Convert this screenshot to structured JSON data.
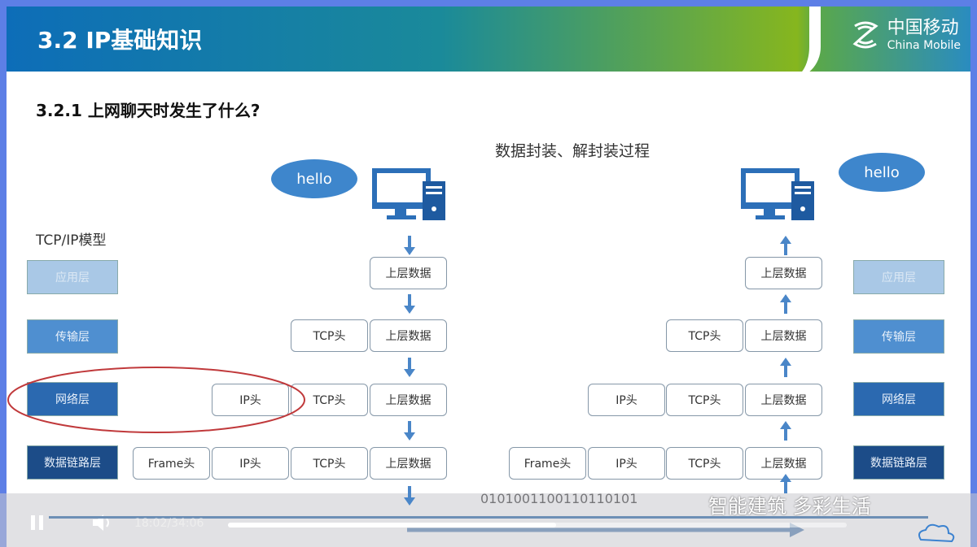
{
  "header": {
    "title": "3.2 IP基础知识",
    "logo_cn": "中国移动",
    "logo_en": "China Mobile"
  },
  "subtitle": "3.2.1 上网聊天时发生了什么?",
  "diagram_title": "数据封装、解封装过程",
  "model_label": "TCP/IP模型",
  "layers": [
    "应用层",
    "传输层",
    "网络层",
    "数据链路层"
  ],
  "bubble": "hello",
  "packets": {
    "frame": "Frame头",
    "ip": "IP头",
    "tcp": "TCP头",
    "data": "上层数据"
  },
  "bits": "0101001100110110101",
  "video": {
    "time": "18:02/34:06",
    "progress": 0.53
  },
  "watermark": "智能建筑 多彩生活",
  "colors": {
    "app": "#a9c8e6",
    "transport": "#4f8fd0",
    "network": "#2b69b0",
    "link": "#1c4c88",
    "highlight": "#c0393b"
  }
}
